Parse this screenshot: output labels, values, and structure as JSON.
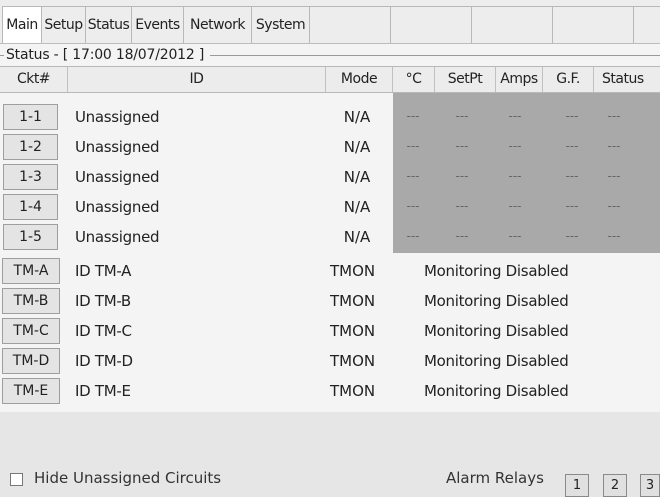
{
  "tabs": [
    "Main",
    "Setup",
    "Status",
    "Events",
    "Network",
    "System"
  ],
  "status_legend": "Status - [ 17:00  18/07/2012 ]",
  "columns": [
    "Ckt#",
    "ID",
    "Mode",
    "°C",
    "SetPt",
    "Amps",
    "G.F.",
    "Status"
  ],
  "circuits": [
    {
      "ckt": "1-1",
      "id": "Unassigned",
      "mode": "N/A",
      "dashes": [
        "---",
        "---",
        "---",
        "---",
        "---"
      ]
    },
    {
      "ckt": "1-2",
      "id": "Unassigned",
      "mode": "N/A",
      "dashes": [
        "---",
        "---",
        "---",
        "---",
        "---"
      ]
    },
    {
      "ckt": "1-3",
      "id": "Unassigned",
      "mode": "N/A",
      "dashes": [
        "---",
        "---",
        "---",
        "---",
        "---"
      ]
    },
    {
      "ckt": "1-4",
      "id": "Unassigned",
      "mode": "N/A",
      "dashes": [
        "---",
        "---",
        "---",
        "---",
        "---"
      ]
    },
    {
      "ckt": "1-5",
      "id": "Unassigned",
      "mode": "N/A",
      "dashes": [
        "---",
        "---",
        "---",
        "---",
        "---"
      ]
    }
  ],
  "monitors": [
    {
      "ckt": "TM-A",
      "id": "ID TM-A",
      "mode": "TMON",
      "status": "Monitoring Disabled"
    },
    {
      "ckt": "TM-B",
      "id": "ID TM-B",
      "mode": "TMON",
      "status": "Monitoring Disabled"
    },
    {
      "ckt": "TM-C",
      "id": "ID TM-C",
      "mode": "TMON",
      "status": "Monitoring Disabled"
    },
    {
      "ckt": "TM-D",
      "id": "ID TM-D",
      "mode": "TMON",
      "status": "Monitoring Disabled"
    },
    {
      "ckt": "TM-E",
      "id": "ID TM-E",
      "mode": "TMON",
      "status": "Monitoring Disabled"
    }
  ],
  "footer": {
    "hide_unassigned_label": "Hide Unassigned Circuits",
    "alarm_relays_label": "Alarm Relays",
    "relay_buttons": [
      "1",
      "2",
      "3"
    ]
  }
}
